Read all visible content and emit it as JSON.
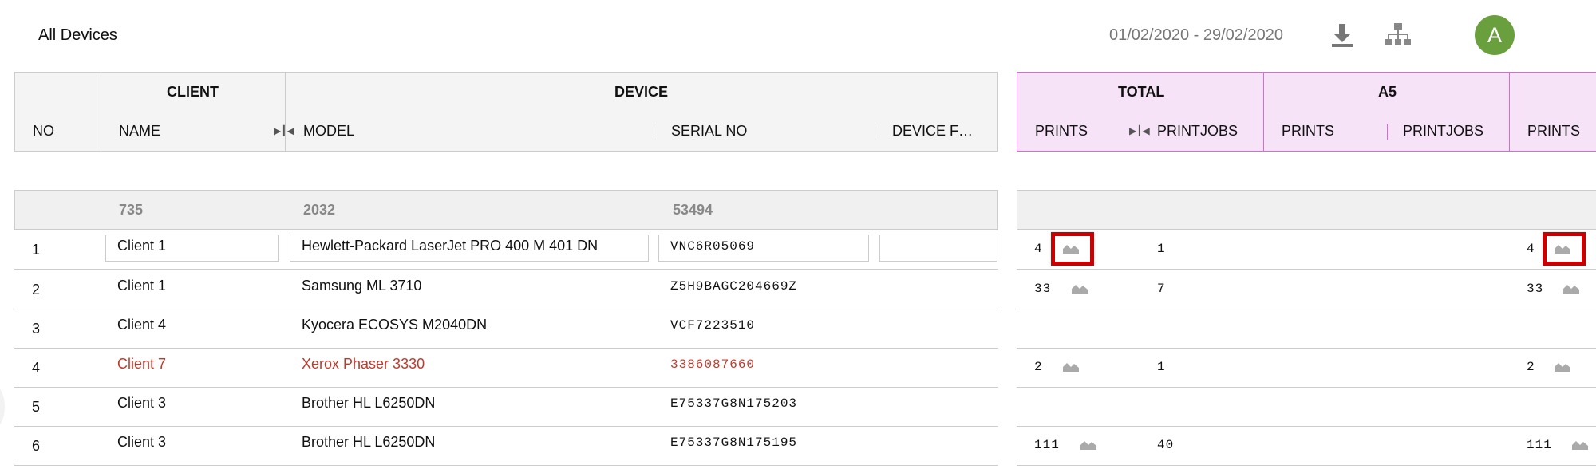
{
  "header": {
    "title": "All Devices",
    "date_range": "01/02/2020 - 29/02/2020",
    "avatar_initial": "A"
  },
  "table": {
    "group_headers": {
      "client": "CLIENT",
      "device": "DEVICE",
      "total": "TOTAL",
      "a5": "A5"
    },
    "columns": {
      "no": "NO",
      "name": "NAME",
      "model": "MODEL",
      "serial": "SERIAL NO",
      "device_f": "DEVICE F…",
      "total_prints": "PRINTS",
      "total_printjobs": "PRINTJOBS",
      "a5_prints": "PRINTS",
      "a5_printjobs": "PRINTJOBS",
      "next_prints": "PRINTS"
    },
    "summary": {
      "name_count": "735",
      "model_count": "2032",
      "serial_count": "53494"
    },
    "rows": [
      {
        "no": "1",
        "client": "Client 1",
        "model": "Hewlett-Packard LaserJet PRO 400 M 401 DN",
        "serial": "VNC6R05069",
        "total_prints": "4",
        "total_printjobs": "1",
        "next_prints": "4"
      },
      {
        "no": "2",
        "client": "Client 1",
        "model": "Samsung ML 3710",
        "serial": "Z5H9BAGC204669Z",
        "total_prints": "33",
        "total_printjobs": "7",
        "next_prints": "33"
      },
      {
        "no": "3",
        "client": "Client 4",
        "model": "Kyocera ECOSYS M2040DN",
        "serial": "VCF7223510",
        "total_prints": "",
        "total_printjobs": "",
        "next_prints": ""
      },
      {
        "no": "4",
        "client": "Client 7",
        "model": "Xerox Phaser 3330",
        "serial": "3386087660",
        "total_prints": "2",
        "total_printjobs": "1",
        "next_prints": "2"
      },
      {
        "no": "5",
        "client": "Client 3",
        "model": "Brother HL L6250DN",
        "serial": "E75337G8N175203",
        "total_prints": "",
        "total_printjobs": "",
        "next_prints": ""
      },
      {
        "no": "6",
        "client": "Client 3",
        "model": "Brother HL L6250DN",
        "serial": "E75337G8N175195",
        "total_prints": "111",
        "total_printjobs": "40",
        "next_prints": "111"
      }
    ]
  },
  "colors": {
    "highlight_row_text": "#c0392b",
    "metrics_header_bg": "#f7e3f7",
    "avatar_bg": "#6a9f3e",
    "annotation_box": "#cc0000"
  },
  "icons": {
    "download": "download-icon",
    "hierarchy": "hierarchy-icon",
    "chart": "area-chart-icon"
  }
}
